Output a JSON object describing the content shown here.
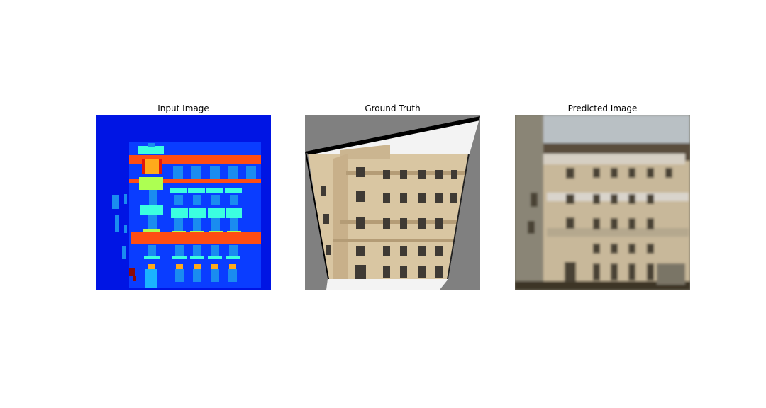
{
  "figure": {
    "panels": [
      {
        "title": "Input Image"
      },
      {
        "title": "Ground Truth"
      },
      {
        "title": "Predicted Image"
      }
    ]
  },
  "colors": {
    "label_background": "#0015e4",
    "label_wall": "#0a3dff",
    "label_cornice": "#ff4d13",
    "label_window": "#1a8cf0",
    "label_sill": "#ffaa1b",
    "label_balcony": "#3bffe0",
    "label_deco": "#adff52",
    "photo_wall": "#d8c4a0",
    "photo_sky": "#f2f2f2",
    "photo_padding": "#808080"
  }
}
